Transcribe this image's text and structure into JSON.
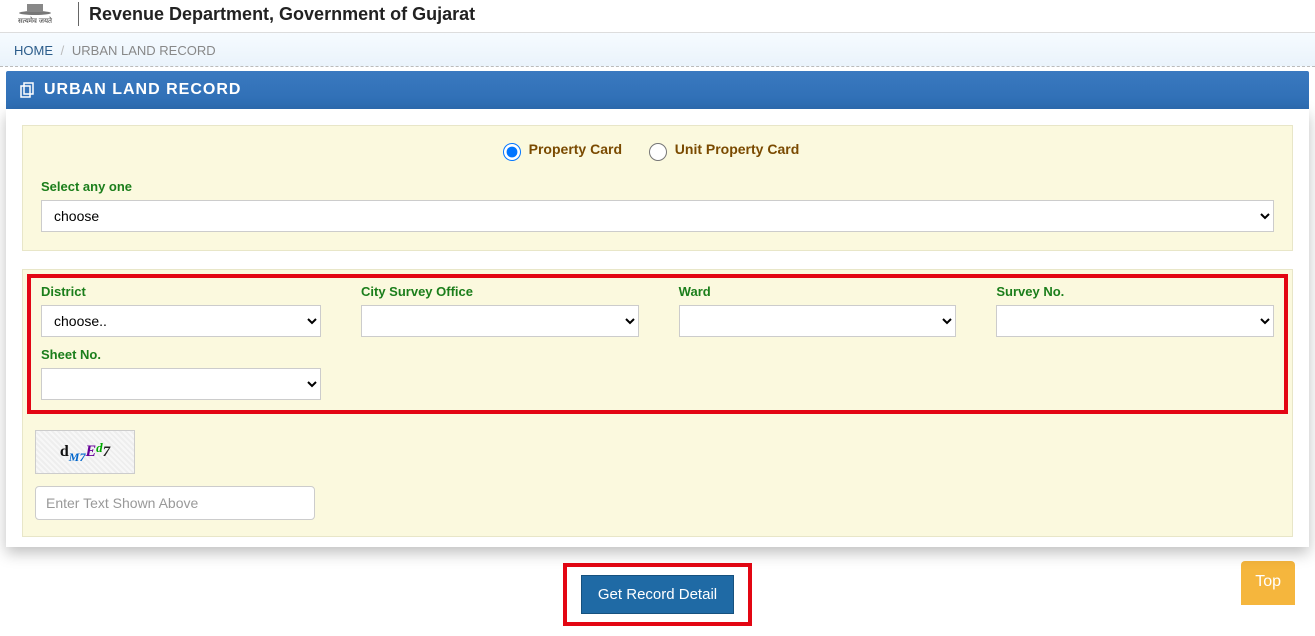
{
  "header": {
    "emblem_caption": "सत्यमेव जयते",
    "site_title": "Revenue Department, Government of Gujarat"
  },
  "breadcrumb": {
    "home": "HOME",
    "sep": "/",
    "current": "URBAN LAND RECORD"
  },
  "panel": {
    "title": "URBAN LAND RECORD"
  },
  "radios": {
    "property_card": "Property Card",
    "unit_property_card": "Unit Property Card"
  },
  "select_any": {
    "label": "Select any one",
    "option": "choose"
  },
  "filters": {
    "district": {
      "label": "District",
      "option": "choose.."
    },
    "cso": {
      "label": "City Survey Office",
      "option": ""
    },
    "ward": {
      "label": "Ward",
      "option": ""
    },
    "survey_no": {
      "label": "Survey No.",
      "option": ""
    },
    "sheet_no": {
      "label": "Sheet No.",
      "option": ""
    }
  },
  "captcha": {
    "chars": {
      "c1": "d",
      "c2": "M7",
      "c3": "E",
      "c4": "d",
      "c5": "7"
    },
    "placeholder": "Enter Text Shown Above"
  },
  "submit": {
    "label": "Get Record Detail"
  },
  "top_button": "Top"
}
